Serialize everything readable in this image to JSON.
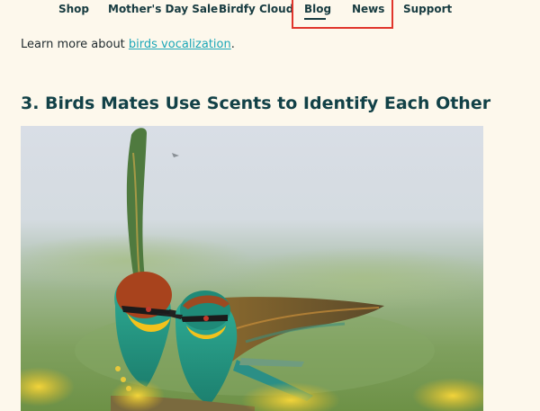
{
  "nav": {
    "items": [
      {
        "label": "Shop"
      },
      {
        "label": "Mother's Day Sale"
      },
      {
        "label": "Birdfy Cloud"
      },
      {
        "label": "Blog"
      },
      {
        "label": "News"
      },
      {
        "label": "Support"
      }
    ],
    "active": "Blog"
  },
  "intro": {
    "prefix": "Learn more about ",
    "link_text": "birds vocalization",
    "suffix": "."
  },
  "section": {
    "heading": "3. Birds Mates Use Scents to Identify Each Other"
  },
  "photo": {
    "subject": "two bee-eater birds perched on a branch"
  },
  "colors": {
    "background": "#fdf8ec",
    "link": "#1ca7b8",
    "heading": "#124147",
    "highlight": "#e0352b"
  }
}
